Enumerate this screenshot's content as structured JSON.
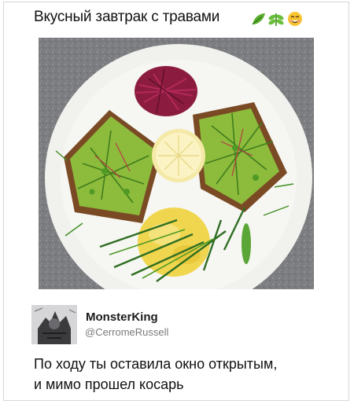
{
  "post": {
    "caption": "Вкусный завтрак с травами",
    "caption_icons": [
      "herb-leaf-icon",
      "herb-sprig-icon",
      "smiling-face-icon"
    ]
  },
  "photo": {
    "subject": "plate-with-avocado-toast",
    "colors": {
      "plate": "#f1f1ee",
      "background": "#7c7d80",
      "avocado": "#8dbb3c",
      "egg": "#f0d64f",
      "beet": "#8c1c3f"
    }
  },
  "tweet": {
    "author_name": "MonsterKing",
    "author_handle": "@CerromeRussell",
    "text_lines": [
      "По ходу ты оставила окно открытым,",
      "и мимо прошел косарь"
    ]
  }
}
